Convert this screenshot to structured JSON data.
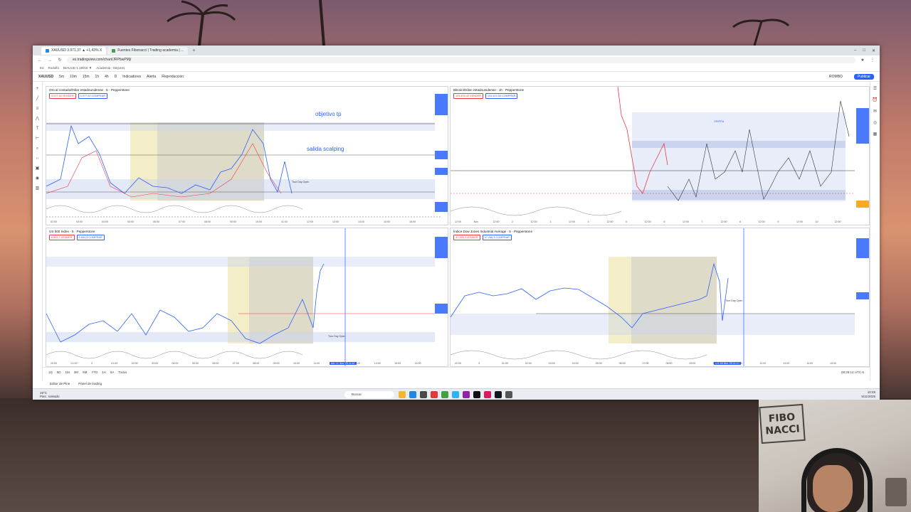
{
  "browser": {
    "tabs": [
      {
        "label": "XAUUSD 3.971,37 ▲ +1,43% X"
      },
      {
        "label": "Fuentes Fibonacci | Trading academia | ..."
      }
    ],
    "url": "es.tradingview.com/chart/JRPbwPMj/",
    "bookmarks": [
      "Ed",
      "Rodolfo",
      "BIAUUD 1.18016 ▼",
      "Academia - Mejores"
    ]
  },
  "tv_toolbar": {
    "symbol": "XAUUSD",
    "interval": "5m",
    "items": [
      "1m",
      "10m",
      "15m",
      "1h",
      "4h",
      "D",
      "1m",
      "Indicadores",
      "Alerta",
      "Reproducción"
    ],
    "right_items": [
      "ROMBO"
    ],
    "publish": "Publicar"
  },
  "charts": {
    "gold": {
      "title": "Oro al contado/Dólar estadounidense · 5 · Pepperstone",
      "sell": "3.977,30 VENDER",
      "buy": "3.977,52 COMPRAR",
      "annotation_tp": "objetivo tp",
      "annotation_scalp": "salida scalping",
      "time_labels": [
        "02:00",
        "03:00",
        "04:00",
        "05:00",
        "06:00",
        "07:00",
        "08:00",
        "09:00",
        "10:00",
        "11:00",
        "12:00",
        "13:00",
        "14:00",
        "15:00",
        "16:00"
      ],
      "note": "True Day Open"
    },
    "btc": {
      "title": "Bitcoin/Dólar estadounidense · 1h · Pepperstone",
      "sell": "103.405,40 VENDER",
      "buy": "103.423,35 COMPRAR",
      "oferta": "OFERTA",
      "time_labels": [
        "12:00",
        "Nov",
        "12:00",
        "2",
        "12:00",
        "3",
        "12:00",
        "4",
        "12:00",
        "5",
        "12:00",
        "6",
        "12:00",
        "7",
        "12:00",
        "8",
        "12:00",
        "9",
        "12:00",
        "10",
        "12:00"
      ]
    },
    "spx": {
      "title": "US 500 Index · 5 · Pepperstone",
      "sell": "6.803,7 VENDER",
      "buy": "6.804,3 COMPRAR",
      "note": "True Day Open",
      "time_labels": [
        "19:00",
        "21:00",
        "3",
        "01:00",
        "02:00",
        "03:00",
        "04:00",
        "05:00",
        "06:00",
        "07:00",
        "08:00",
        "09:00",
        "10:00",
        "11:00",
        "12:00",
        "13:00",
        "14:00",
        "15:00",
        "16:00"
      ],
      "time_highlight": "mié 05 Nov '25  11:40"
    },
    "dji": {
      "title": "Índice Dow Jones Industrial Average · 5 · Pepperstone",
      "sell": "47.258,3 VENDER",
      "buy": "47.266,3 COMPRAR",
      "note": "True Day Open",
      "time_labels": [
        "22:00",
        "3",
        "01:00",
        "02:00",
        "03:00",
        "04:00",
        "05:00",
        "06:00",
        "07:00",
        "08:00",
        "09:00",
        "10:00",
        "11:00",
        "12:00",
        "13:00",
        "14:00",
        "15:00"
      ],
      "time_highlight": "mié 05 Nov '25  11:40"
    }
  },
  "bottom": {
    "ranges": [
      "1D",
      "5D",
      "1M",
      "3M",
      "6M",
      "YTD",
      "1A",
      "5A",
      "Todos"
    ],
    "panels": [
      "Editor de Pine",
      "Panel de trading"
    ],
    "clock": "08:28:14 UTC-5"
  },
  "taskbar": {
    "weather_temp": "19°C",
    "weather_desc": "Parc. soleado",
    "search": "Buscar",
    "time": "10:28",
    "date": "5/11/2025"
  },
  "webcam": {
    "sign_line1": "FIBO",
    "sign_line2": "NACCI"
  },
  "colors": {
    "accent": "#2962ff",
    "up": "#2962ff",
    "down": "#f23645",
    "zone_yellow": "#f3eec8",
    "zone_gray": "#c9c9c9"
  }
}
